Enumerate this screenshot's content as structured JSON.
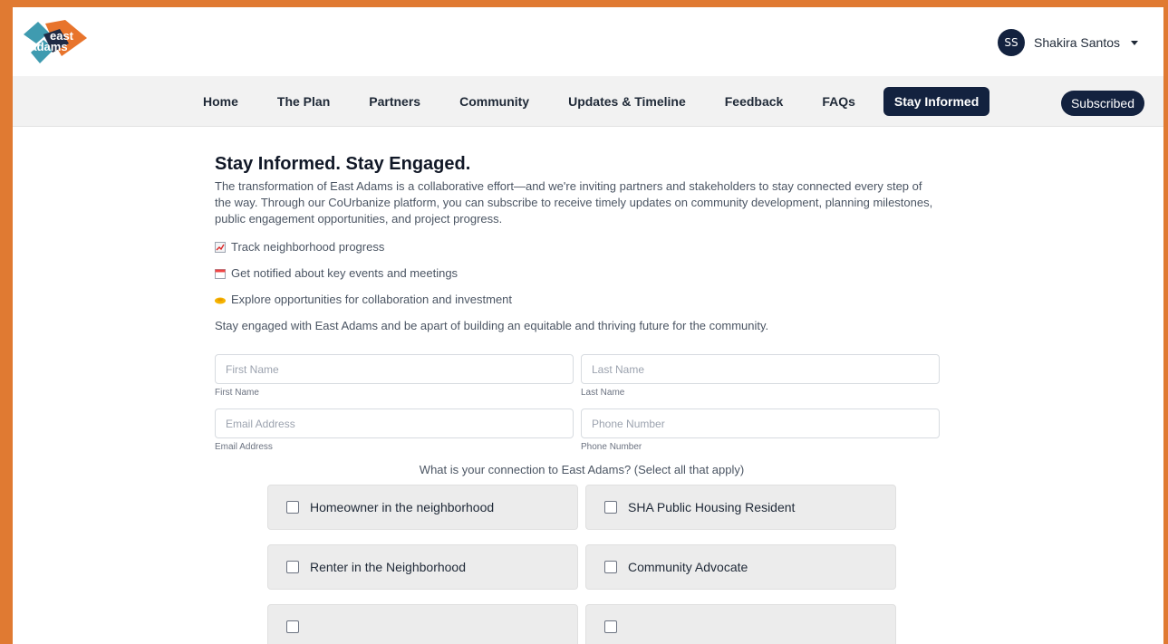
{
  "header": {
    "logo_text": "east adams",
    "user": {
      "initials": "SS",
      "name": "Shakira Santos"
    }
  },
  "nav": {
    "items": [
      {
        "label": "Home"
      },
      {
        "label": "The Plan"
      },
      {
        "label": "Partners"
      },
      {
        "label": "Community"
      },
      {
        "label": "Updates & Timeline"
      },
      {
        "label": "Feedback"
      },
      {
        "label": "FAQs"
      },
      {
        "label": "Stay Informed",
        "active": true
      }
    ],
    "subscribed_label": "Subscribed"
  },
  "main": {
    "title": "Stay Informed. Stay Engaged.",
    "intro": "The transformation of East Adams is a collaborative effort—and we're inviting partners and stakeholders to stay connected every step of the way. Through our CoUrbanize platform, you can subscribe to receive timely updates on community development, planning milestones, public engagement opportunities, and project progress.",
    "bullets": [
      {
        "icon": "chart-icon",
        "text": "Track neighborhood progress"
      },
      {
        "icon": "calendar-icon",
        "text": "Get notified about key events and meetings"
      },
      {
        "icon": "handshake-icon",
        "text": "Explore opportunities for collaboration and investment"
      }
    ],
    "closing": "Stay engaged with East Adams and be apart of building an equitable and thriving future for the community."
  },
  "form": {
    "first_name": {
      "placeholder": "First Name",
      "label": "First Name",
      "value": ""
    },
    "last_name": {
      "placeholder": "Last Name",
      "label": "Last Name",
      "value": ""
    },
    "email": {
      "placeholder": "Email Address",
      "label": "Email Address",
      "value": ""
    },
    "phone": {
      "placeholder": "Phone Number",
      "label": "Phone Number",
      "value": ""
    },
    "connection_question": "What is your connection to East Adams? (Select all that apply)",
    "options": [
      {
        "label": "Homeowner in the neighborhood",
        "checked": false
      },
      {
        "label": "SHA Public Housing Resident",
        "checked": false
      },
      {
        "label": "Renter in the Neighborhood",
        "checked": false
      },
      {
        "label": "Community Advocate",
        "checked": false
      }
    ]
  },
  "colors": {
    "frame_border": "#e07a32",
    "navy": "#13223f",
    "logo_orange": "#e8742c",
    "logo_teal": "#3f9bb0"
  }
}
